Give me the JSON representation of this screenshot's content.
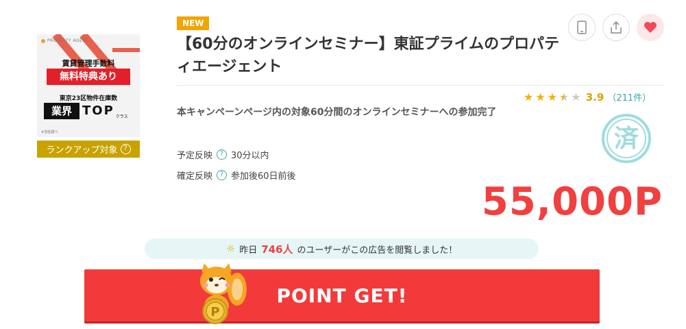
{
  "thumbnail": {
    "brand": "PROPERTY AGENT",
    "fee_text": "賃貸管理手数料",
    "special_text": "無料特典あり",
    "inventory_text": "東京23区物件在庫数",
    "gyokai": "業界",
    "top": "TOP",
    "klass": "クラス",
    "note": "※当社調べ",
    "rankup_label": "ランクアップ対象"
  },
  "badge": "NEW",
  "title": "【60分のオンラインセミナー】東証プライムのプロパティエージェント",
  "actions": [
    "mobile-icon",
    "share-icon",
    "heart-icon"
  ],
  "rating": {
    "stars": 3.5,
    "score": "3.9",
    "count_open": "（",
    "count": "211件",
    "count_close": "）"
  },
  "description": "本キャンペーンページ内の対象60分間のオンラインセミナーへの参加完了",
  "scheduled": {
    "label": "予定反映",
    "value": "30分以内"
  },
  "confirmed": {
    "label": "確定反映",
    "value": "参加後60日前後"
  },
  "stamp": "済",
  "points": "55,000P",
  "viewed": {
    "prefix": "昨日",
    "count": "746人",
    "suffix": "のユーザーがこの広告を閲覧しました！"
  },
  "cta": "POINT GET!",
  "colors": {
    "accent": "#f23a3a",
    "badge": "#f0a500",
    "rankup": "#c9a200",
    "teal": "#3aa6a6"
  }
}
